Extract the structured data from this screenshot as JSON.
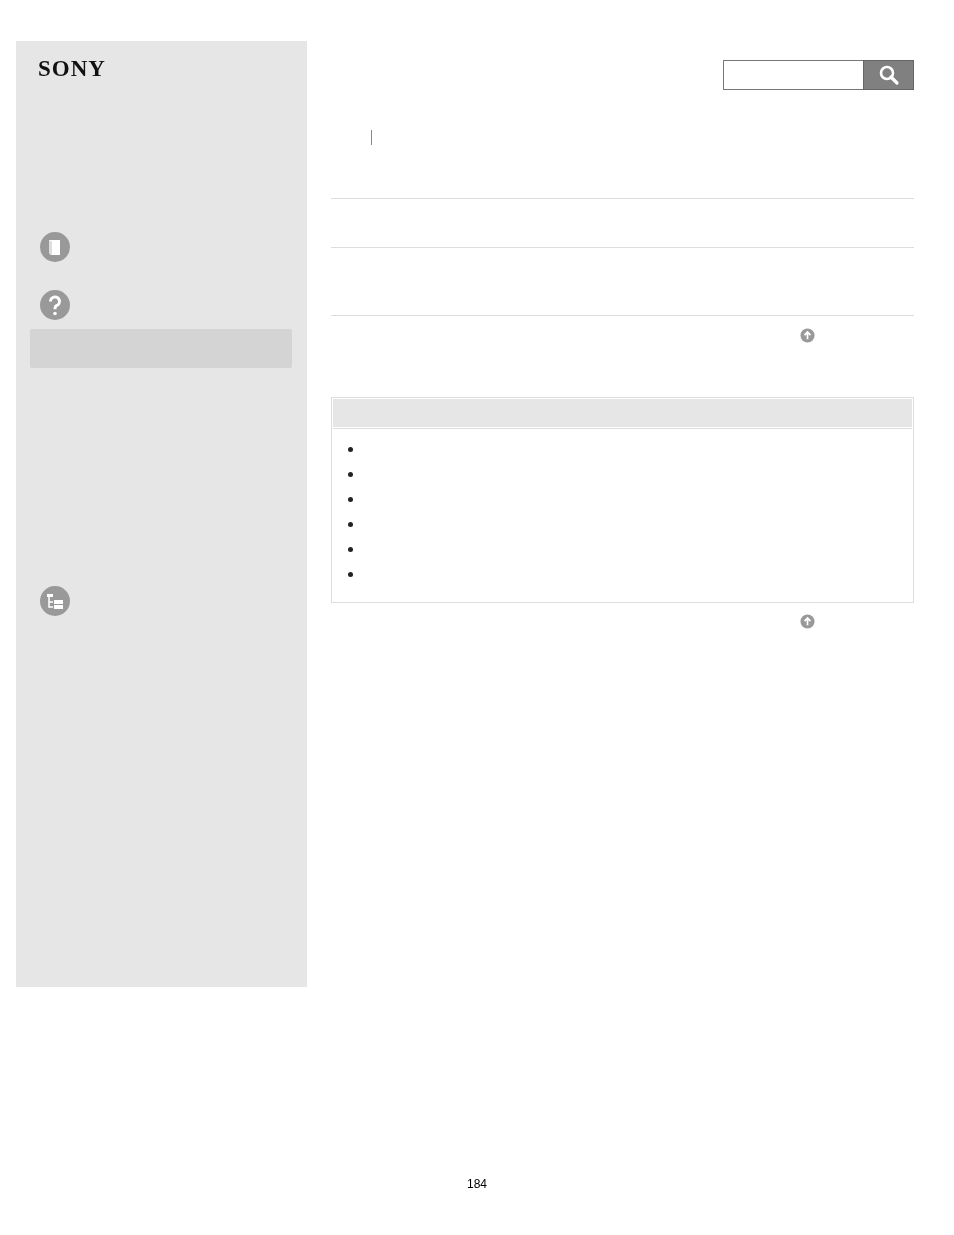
{
  "sidebar": {
    "logo": "SONY"
  },
  "footer": {
    "page_number": "184"
  }
}
